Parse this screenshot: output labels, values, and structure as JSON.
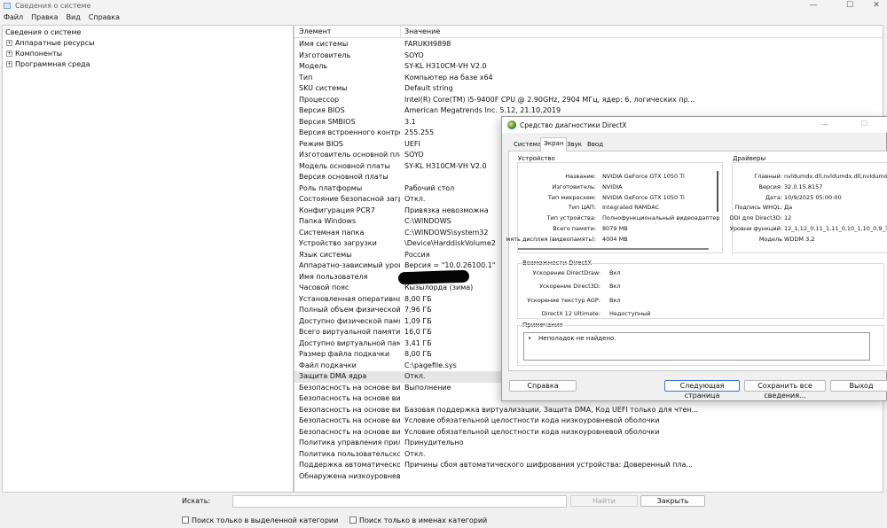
{
  "window": {
    "title": "Сведения о системе",
    "controls": {
      "minimize": "—",
      "maximize": "☐",
      "close": "✕"
    }
  },
  "menu": [
    "Файл",
    "Правка",
    "Вид",
    "Справка"
  ],
  "tree": {
    "root": "Сведения о системе",
    "children": [
      "Аппаратные ресурсы",
      "Компоненты",
      "Программная среда"
    ]
  },
  "list": {
    "headers": {
      "item": "Элемент",
      "value": "Значение"
    },
    "rows": [
      {
        "item": "Имя системы",
        "value": "FARUKH9898"
      },
      {
        "item": "Изготовитель",
        "value": "SOYO"
      },
      {
        "item": "Модель",
        "value": "SY-KL H310CM-VH V2.0"
      },
      {
        "item": "Тип",
        "value": "Компьютер на базе x64"
      },
      {
        "item": "SKU системы",
        "value": "Default string"
      },
      {
        "item": "Процессор",
        "value": "Intel(R) Core(TM) i5-9400F CPU @ 2.90GHz, 2904 МГц, ядер: 6, логических пр..."
      },
      {
        "item": "Версия BIOS",
        "value": "American Megatrends Inc. 5.12, 21.10.2019"
      },
      {
        "item": "Версия SMBIOS",
        "value": "3.1"
      },
      {
        "item": "Версия встроенного контролл...",
        "value": "255.255"
      },
      {
        "item": "Режим BIOS",
        "value": "UEFI"
      },
      {
        "item": "Изготовитель основной платы",
        "value": "SOYO"
      },
      {
        "item": "Модель основной платы",
        "value": "SY-KL H310CM-VH V2.0"
      },
      {
        "item": "Версия основной платы",
        "value": ""
      },
      {
        "item": "Роль платформы",
        "value": "Рабочий стол"
      },
      {
        "item": "Состояние безопасной загрузк...",
        "value": "Откл."
      },
      {
        "item": "Конфигурация PCR7",
        "value": "Привязка невозможна"
      },
      {
        "item": "Папка Windows",
        "value": "C:\\WINDOWS"
      },
      {
        "item": "Системная папка",
        "value": "C:\\WINDOWS\\system32"
      },
      {
        "item": "Устройство загрузки",
        "value": "\\Device\\HarddiskVolume2"
      },
      {
        "item": "Язык системы",
        "value": "Россия"
      },
      {
        "item": "Аппаратно-зависимый уровен...",
        "value": "Версия = \"10.0.26100.1\""
      },
      {
        "item": "Имя пользователя",
        "value": ""
      },
      {
        "item": "Часовой пояс",
        "value": "Кызылорда (зима)"
      },
      {
        "item": "Установленная оперативная п...",
        "value": "8,00 ГБ"
      },
      {
        "item": "Полный объем физической па...",
        "value": "7,96 ГБ"
      },
      {
        "item": "Доступно физической памяти",
        "value": "1,09 ГБ"
      },
      {
        "item": "Всего виртуальной памяти",
        "value": "16,0 ГБ"
      },
      {
        "item": "Доступно виртуальной памяти",
        "value": "3,41 ГБ"
      },
      {
        "item": "Размер файла подкачки",
        "value": "8,00 ГБ"
      },
      {
        "item": "Файл подкачки",
        "value": "C:\\pagefile.sys"
      },
      {
        "item": "Защита DMA ядра",
        "value": "Откл."
      },
      {
        "item": "Безопасность на основе вирту...",
        "value": "Выполнение"
      },
      {
        "item": "Безопасность на основе вирту...",
        "value": ""
      },
      {
        "item": "Безопасность на основе вирту...",
        "value": "Базовая поддержка виртуализации, Защита DMA, Код UEFI только для чтен..."
      },
      {
        "item": "Безопасность на основе вирту...",
        "value": "Условие обязательной целостности кода низкоуровневой оболочки"
      },
      {
        "item": "Безопасность на основе вирту...",
        "value": "Условие обязательной целостности кода низкоуровневой оболочки"
      },
      {
        "item": "Политика управления прилож...",
        "value": "Принудительно"
      },
      {
        "item": "Политика пользовательского...",
        "value": "Откл."
      },
      {
        "item": "Поддержка автоматического ...",
        "value": "Причины сбоя автоматического шифрования устройства: Доверенный пла..."
      },
      {
        "item": "Обнаружена низкоуровневая ...",
        "value": ""
      }
    ]
  },
  "search": {
    "label": "Искать:",
    "value": "",
    "find_button": "Найти",
    "close_button": "Закрыть",
    "check_selected_category": "Поиск только в выделенной категории",
    "check_category_names": "Поиск только в именах категорий"
  },
  "directx": {
    "title": "Средство диагностики DirectX",
    "tabs": [
      "Система",
      "Экран",
      "Звук",
      "Ввод"
    ],
    "active_tab": "Экран",
    "device_group": "Устройство",
    "device": [
      {
        "k": "Название:",
        "v": "NVIDIA GeForce GTX 1050 Ti"
      },
      {
        "k": "Изготовитель:",
        "v": "NVIDIA"
      },
      {
        "k": "Тип микросхем:",
        "v": "NVIDIA GeForce GTX 1050 Ti"
      },
      {
        "k": "Тип ЦАП:",
        "v": "Integrated RAMDAC"
      },
      {
        "k": "Тип устройства:",
        "v": "Полнофункциональный видеоадаптер"
      },
      {
        "k": "Всего памяти:",
        "v": "8079 MB"
      },
      {
        "k": "мять дисплея (видеопамять):",
        "v": "4004 MB"
      }
    ],
    "drivers_group": "Драйверы",
    "drivers": [
      {
        "k": "Главный:",
        "v": "nvldumdx.dll,nvldumdx.dll,nvldumdx.dl"
      },
      {
        "k": "Версия:",
        "v": "32.0.15.8157"
      },
      {
        "k": "Дата:",
        "v": "10/9/2025 05:00:00"
      },
      {
        "k": "Подпись WHQL:",
        "v": "Да"
      },
      {
        "k": "DDI для Direct3D:",
        "v": "12"
      },
      {
        "k": "Уровни функций:",
        "v": "12_1,12_0,11_1,11_0,10_1,10_0,9_3"
      },
      {
        "k": "Модель",
        "v": "WDDM 3.2"
      }
    ],
    "features_group": "Возможности DirectX",
    "features": [
      {
        "k": "Ускорение DirectDraw:",
        "v": "Вкл"
      },
      {
        "k": "Ускорение Direct3D:",
        "v": "Вкл"
      },
      {
        "k": "Ускорение текстур AGP:",
        "v": "Вкл"
      },
      {
        "k": "DirectX 12 Ultimate:",
        "v": "Недоступный"
      }
    ],
    "notes_group": "Примечания",
    "notes_bullet": "•",
    "notes_text": "Неполадок не найдено.",
    "buttons": {
      "help": "Справка",
      "next_page": "Следующая страница",
      "save_all": "Сохранить все сведения...",
      "exit": "Выход"
    }
  }
}
